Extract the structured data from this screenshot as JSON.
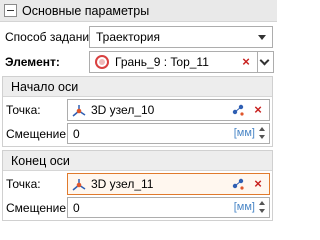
{
  "header": {
    "title": "Основные параметры",
    "toggle_icon": "collapse-minus-icon"
  },
  "method": {
    "label": "Способ задания:",
    "value": "Траектория"
  },
  "element": {
    "label": "Элемент:",
    "value": "Грань_9 : Top_11",
    "icon": "face-ring-icon",
    "clear_label": "×"
  },
  "axis_start": {
    "title": "Начало оси",
    "point_label": "Точка:",
    "point_value": "3D узел_10",
    "point_clear": "×",
    "offset_label": "Смещение:",
    "offset_value": "0",
    "unit": "[мм]"
  },
  "axis_end": {
    "title": "Конец оси",
    "point_label": "Точка:",
    "point_value": "3D узел_11",
    "point_clear": "×",
    "offset_label": "Смещение:",
    "offset_value": "0",
    "unit": "[мм]"
  },
  "colors": {
    "accent_orange": "#e07a2c",
    "danger_red": "#c8201e",
    "unit_blue": "#4a86c6",
    "node_blue": "#2f5fb3"
  }
}
